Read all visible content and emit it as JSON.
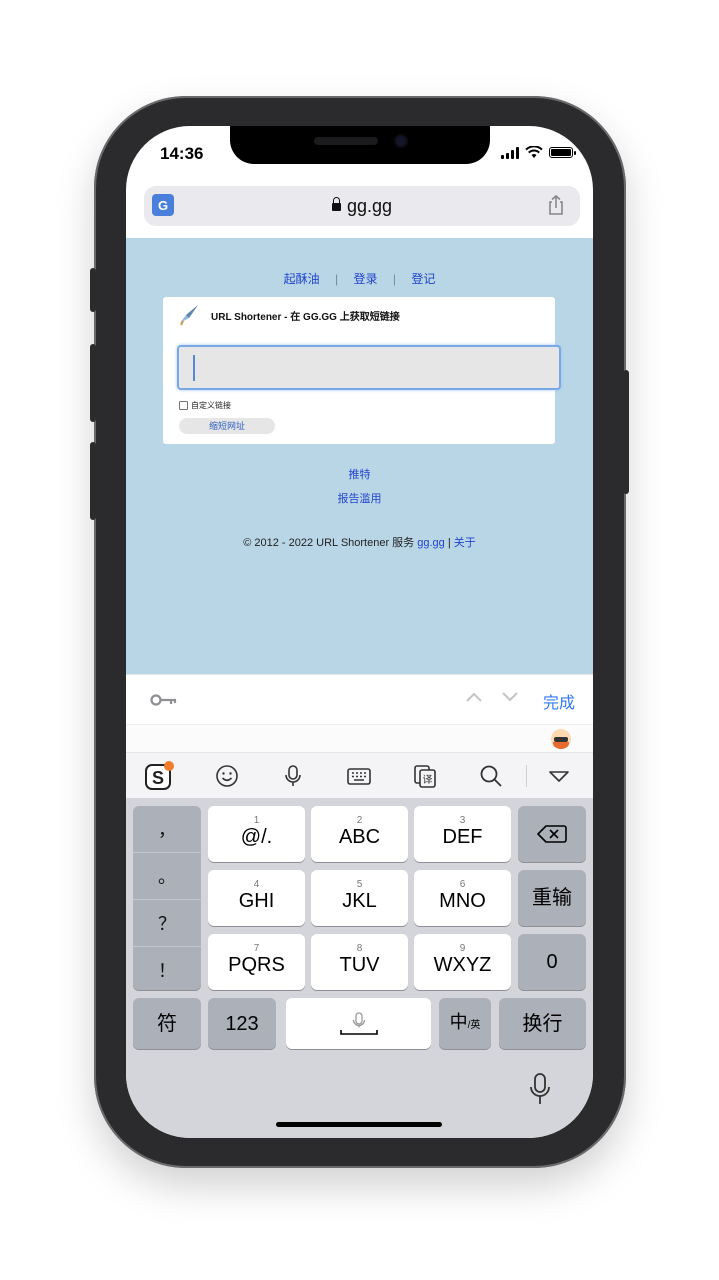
{
  "status_bar": {
    "time": "14:36"
  },
  "browser": {
    "translate_icon_text": "G",
    "url": "gg.gg"
  },
  "webpage": {
    "nav": [
      "起酥油",
      "登录",
      "登记"
    ],
    "nav_separator": "|",
    "card_title": "URL Shortener - 在 GG.GG 上获取短链接",
    "url_input_value": "",
    "custom_link_label": "自定义链接",
    "shorten_button": "缩短网址",
    "link_tweet": "推特",
    "link_report": "报告滥用",
    "footer_text": "© 2012 - 2022 URL Shortener 服务",
    "footer_link_site": "gg.gg",
    "footer_sep": "|",
    "footer_link_about": "关于"
  },
  "accessory_bar": {
    "done_label": "完成"
  },
  "ime_toolbar": {
    "icons": [
      "sogou-logo-icon",
      "emoji-icon",
      "microphone-icon",
      "keyboard-icon",
      "clipboard-icon",
      "search-icon",
      "collapse-icon"
    ]
  },
  "keyboard": {
    "punctuation": [
      "，",
      "。",
      "？",
      "！"
    ],
    "keys": [
      {
        "num": "1",
        "label": "@/."
      },
      {
        "num": "2",
        "label": "ABC"
      },
      {
        "num": "3",
        "label": "DEF"
      },
      {
        "num": "4",
        "label": "GHI"
      },
      {
        "num": "5",
        "label": "JKL"
      },
      {
        "num": "6",
        "label": "MNO"
      },
      {
        "num": "7",
        "label": "PQRS"
      },
      {
        "num": "8",
        "label": "TUV"
      },
      {
        "num": "9",
        "label": "WXYZ"
      }
    ],
    "retype": "重输",
    "zero": "0",
    "symbols": "符",
    "numbers": "123",
    "lang_main": "中",
    "lang_sub": "/英",
    "return": "换行"
  },
  "colors": {
    "page_background": "#b9d6e6",
    "link": "#2244cc",
    "accent": "#3478f6"
  }
}
